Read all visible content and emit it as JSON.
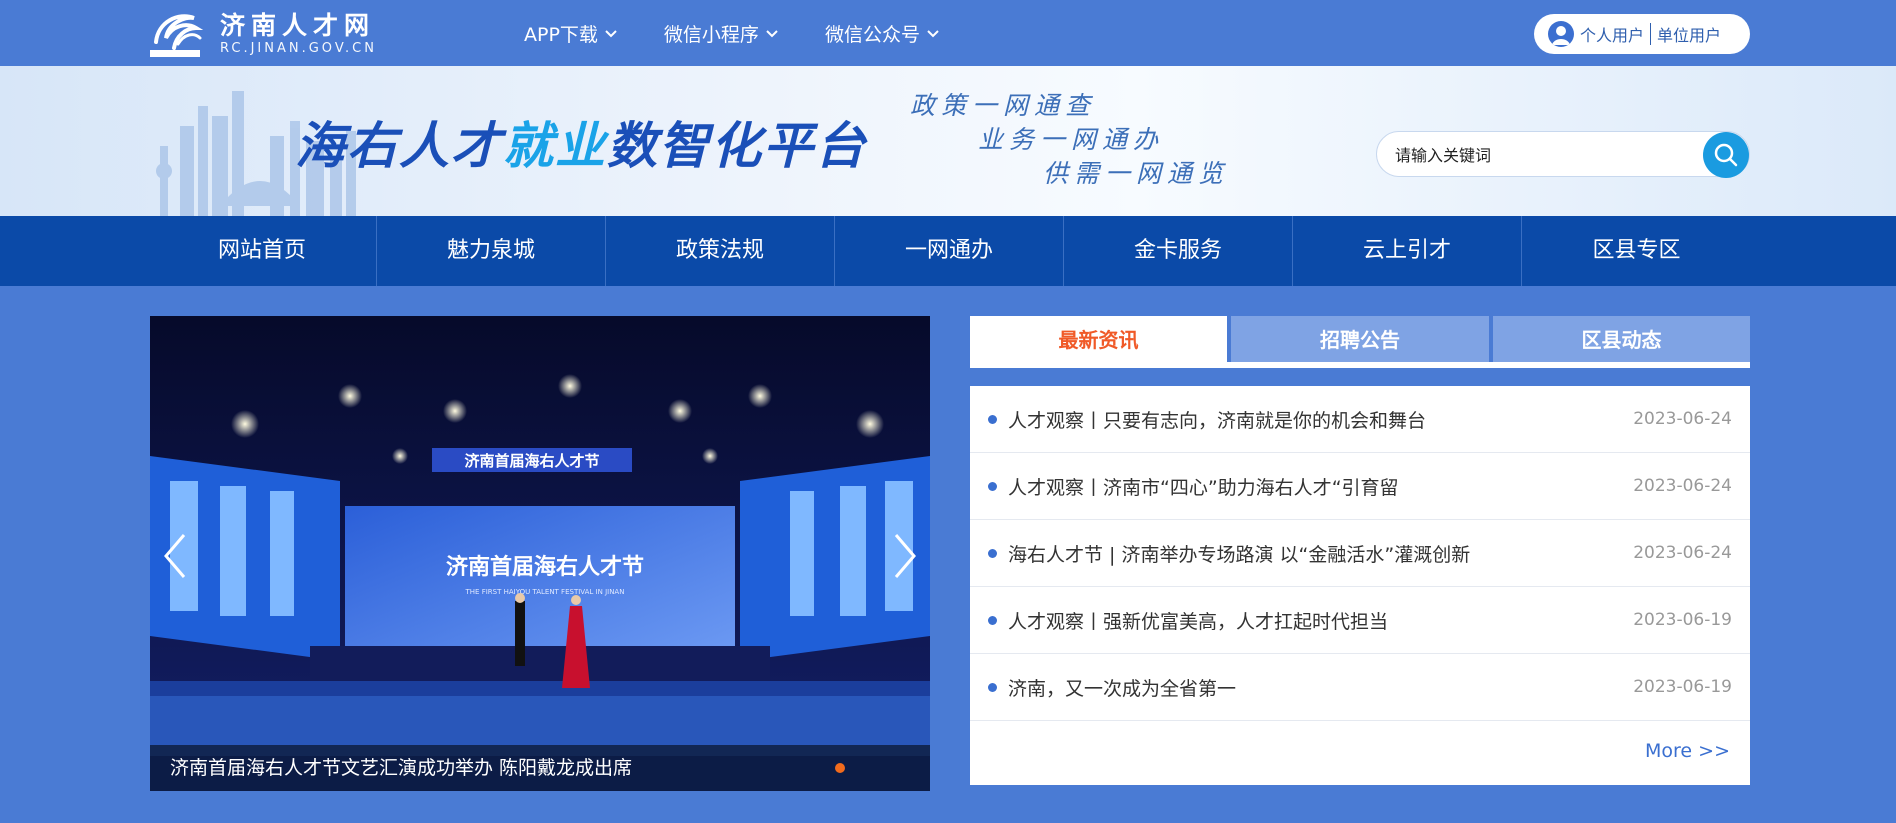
{
  "header": {
    "site_name": "济南人才网",
    "site_url": "RC.JINAN.GOV.CN",
    "nav": [
      {
        "label": "APP下载"
      },
      {
        "label": "微信小程序"
      },
      {
        "label": "微信公众号"
      }
    ],
    "user": {
      "personal": "个人用户",
      "company": "单位用户"
    }
  },
  "banner": {
    "title_part1": "海右人才",
    "title_part2": "就业",
    "title_part3": "数智化平台",
    "slogans": [
      "政策一网通查",
      "业务一网通办",
      "供需一网通览"
    ],
    "search_placeholder": "请输入关键词"
  },
  "mainnav": [
    "网站首页",
    "魅力泉城",
    "政策法规",
    "一网通办",
    "金卡服务",
    "云上引才",
    "区县专区"
  ],
  "carousel": {
    "caption": "济南首届海右人才节文艺汇演成功举办 陈阳戴龙成出席",
    "stage_sign": "济南首届海右人才节",
    "screen_title": "济南首届海右人才节",
    "screen_sub": "THE FIRST HAIYOU TALENT FESTIVAL IN JINAN"
  },
  "news": {
    "tabs": [
      "最新资讯",
      "招聘公告",
      "区县动态"
    ],
    "items": [
      {
        "title": "人才观察丨只要有志向，济南就是你的机会和舞台",
        "date": "2023-06-24"
      },
      {
        "title": "人才观察丨济南市“四心”助力海右人才“引育留",
        "date": "2023-06-24"
      },
      {
        "title": "海右人才节 | 济南举办专场路演 以“金融活水”灌溉创新",
        "date": "2023-06-24"
      },
      {
        "title": "人才观察丨强新优富美高，人才扛起时代担当",
        "date": "2023-06-19"
      },
      {
        "title": "济南，又一次成为全省第一",
        "date": "2023-06-19"
      }
    ],
    "more": "More >>"
  },
  "colors": {
    "topbar": "#4a7bd4",
    "mainnav": "#0b4aa8",
    "tab_active_text": "#f05a28",
    "accent": "#1a9be0"
  }
}
